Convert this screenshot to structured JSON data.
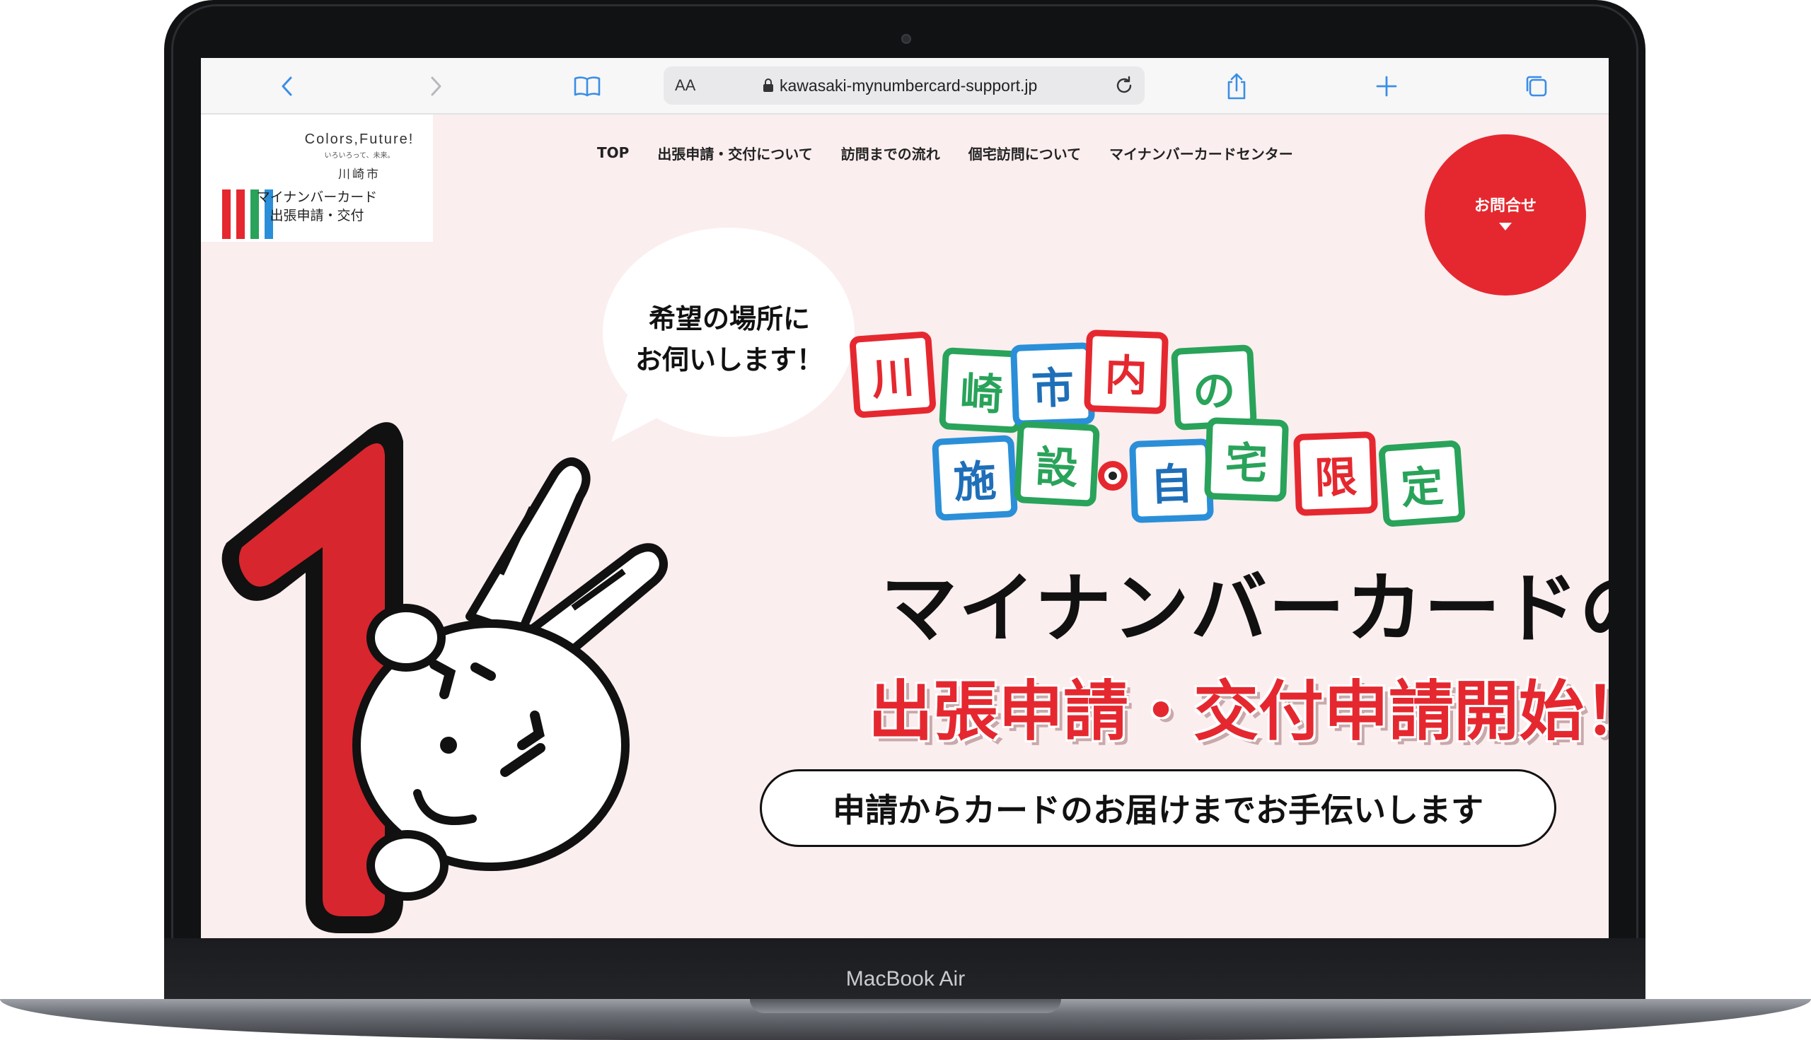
{
  "device": {
    "model": "MacBook Air"
  },
  "browser": {
    "aa_label": "AA",
    "url": "kawasaki-mynumbercard-support.jp"
  },
  "site": {
    "logo": {
      "brand": "Colors,Future!",
      "tagline": "いろいろって、未来。",
      "city": "川崎市",
      "caption_line1": "マイナンバーカード",
      "caption_line2": "出張申請・交付"
    },
    "nav": [
      "TOP",
      "出張申請・交付について",
      "訪問までの流れ",
      "個宅訪問について",
      "マイナンバーカードセンター"
    ],
    "contact_label": "お問合せ"
  },
  "hero": {
    "bubble_line1": "希望の場所に",
    "bubble_line2": "お伺いします！",
    "tiles_row1": [
      "川",
      "崎",
      "市",
      "内",
      "の"
    ],
    "tiles_row2": [
      "施",
      "設",
      "自",
      "宅",
      "限",
      "定"
    ],
    "headline": "マイナンバーカードの",
    "subheadline": "出張申請・交付申請開始！",
    "pill": "申請からカードのお届けまでお手伝いします"
  },
  "colors": {
    "accent_red": "#e5282f",
    "tile_green": "#29a35a",
    "tile_blue": "#2a8fd8",
    "background_pink": "#fbeeef",
    "browser_blue": "#3a8ee6"
  }
}
